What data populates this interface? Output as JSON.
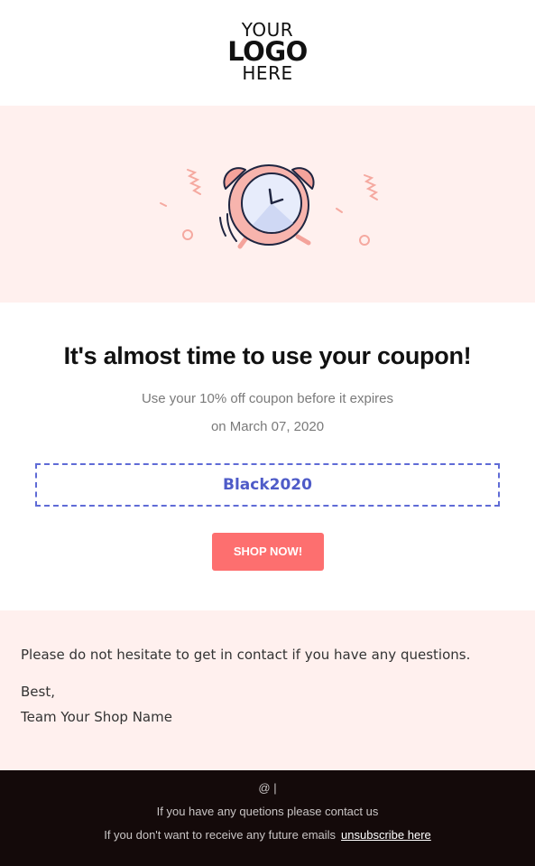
{
  "logo": {
    "line1": "YOUR",
    "line2": "LOGO",
    "line3": "HERE"
  },
  "hero": {
    "icon": "alarm-clock-icon"
  },
  "content": {
    "title": "It's almost time to use your coupon!",
    "subtitle_line1": "Use your 10% off coupon before it expires",
    "subtitle_line2": "on March 07, 2020",
    "coupon_code": "Black2020",
    "shop_button": "SHOP NOW!"
  },
  "closing": {
    "message": "Please do not hesitate to get in contact if you have any questions.",
    "signoff": "Best,",
    "signature": "Team Your Shop Name"
  },
  "footer": {
    "at_line": "@ |",
    "contact_line": "If you have any quetions please contact us",
    "unsubscribe_prefix": "If you don't want to receive any future emails",
    "unsubscribe_link": "unsubscribe here"
  },
  "colors": {
    "accent_pink_bg": "#fff0ee",
    "button": "#fd6f6f",
    "coupon_border": "#5f6bd6",
    "footer_bg": "#140a0a"
  }
}
